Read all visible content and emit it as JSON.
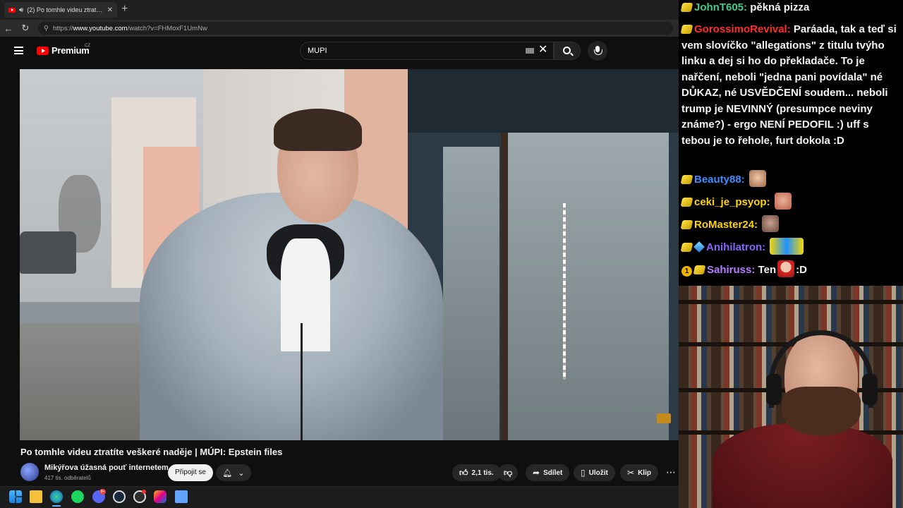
{
  "browser": {
    "tab_title": "(2) Po tomhle videu ztratíte ve...",
    "tab_close": "✕",
    "new_tab": "+",
    "url_scheme": "https://",
    "url_host": "www.youtube.com",
    "url_path": "/watch?v=FHMoxF1UmNw",
    "back": "←",
    "reload": "↻"
  },
  "youtube": {
    "logo_text": "Premium",
    "country_code": "CZ",
    "search_value": "MUPI",
    "clear": "✕",
    "video": {
      "title": "Po tomhle videu ztratíte veškeré naděje | MÚPI: Epstein files",
      "channel_name": "Mikýřova úžasná pouť internetem",
      "subscribers": "417 tis. odběratelů",
      "join_label": "Připojit se",
      "likes": "2,1 tis.",
      "share_label": "Sdílet",
      "save_label": "Uložit",
      "clip_label": "Klip",
      "more": "⋯"
    }
  },
  "taskbar": {
    "discord_badge": "9+"
  },
  "chat": {
    "messages": [
      {
        "user": "JohnT605",
        "color": "#3ecf8e",
        "text": "pěkná pizza"
      },
      {
        "user": "GorossimoRevival",
        "color": "#ff2d2d",
        "text": "Paráada, tak a teď si vem slovíčko \"allegations\" z titulu tvýho linku a dej si ho do překladače. To je nařčení, neboli \"jedna pani povídala\" né DŮKAZ, né USVĚDČENÍ soudem... neboli trump je NEVINNÝ (presumpce neviny známe?) - ergo NENÍ PEDOFIL :) uff s tebou je to řehole, furt dokola :D"
      },
      {
        "user": "Beauty88",
        "color": "#3d8cff",
        "text": ""
      },
      {
        "user": "ceki_je_psyop",
        "color": "#ffd400",
        "text": ""
      },
      {
        "user": "RoMaster24",
        "color": "#ffd400",
        "text": ""
      },
      {
        "user": "Anihilatron",
        "color": "#8a63ff",
        "text": ""
      },
      {
        "user": "Sahiruss",
        "color": "#b57cff",
        "text": "Ten",
        "text_after": ":D",
        "badge_number": "1"
      }
    ]
  }
}
